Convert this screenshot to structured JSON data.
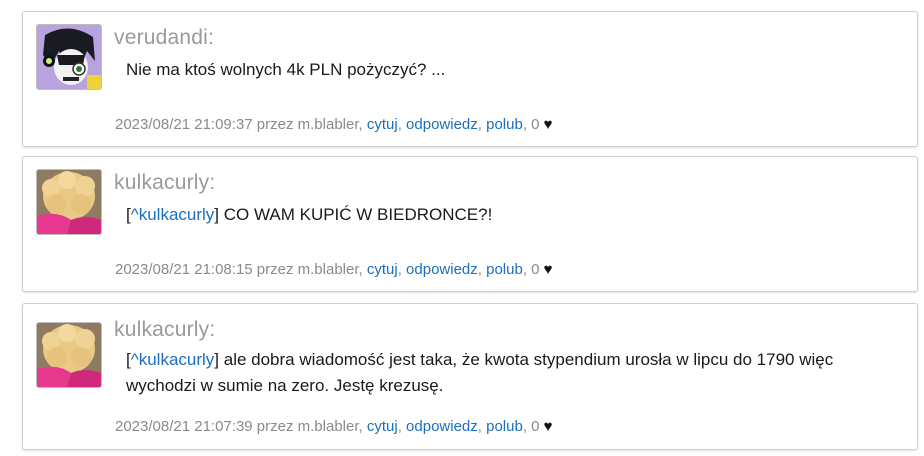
{
  "posts": [
    {
      "author": "verudandi:",
      "text": "Nie ma ktoś wolnych 4k PLN pożyczyć? ...",
      "quote_prefix": "",
      "quote_user": "",
      "quote_suffix": "",
      "meta": {
        "timestamp_by": "2023/08/21 21:09:37 przez m.blabler,",
        "quote": "cytuj",
        "reply": "odpowiedz",
        "like": "polub",
        "likes_count": ", 0"
      }
    },
    {
      "author": "kulkacurly:",
      "quote_prefix": "[",
      "quote_user": "^kulkacurly",
      "quote_suffix": "] CO WAM KUPIĆ W BIEDRONCE?!",
      "meta": {
        "timestamp_by": "2023/08/21 21:08:15 przez m.blabler,",
        "quote": "cytuj",
        "reply": "odpowiedz",
        "like": "polub",
        "likes_count": ", 0"
      }
    },
    {
      "author": "kulkacurly:",
      "quote_prefix": "[",
      "quote_user": "^kulkacurly",
      "quote_suffix": "] ale dobra wiadomość jest taka, że kwota stypendium urosła w lipcu do 1790 więc wychodzi w sumie na zero. Jestę krezusę.",
      "meta": {
        "timestamp_by": "2023/08/21 21:07:39 przez m.blabler,",
        "quote": "cytuj",
        "reply": "odpowiedz",
        "like": "polub",
        "likes_count": ", 0"
      }
    }
  ],
  "icons": {
    "heart": "♥",
    "avatar_1": "anime-character-avatar",
    "avatar_2": "curly-hair-avatar"
  }
}
